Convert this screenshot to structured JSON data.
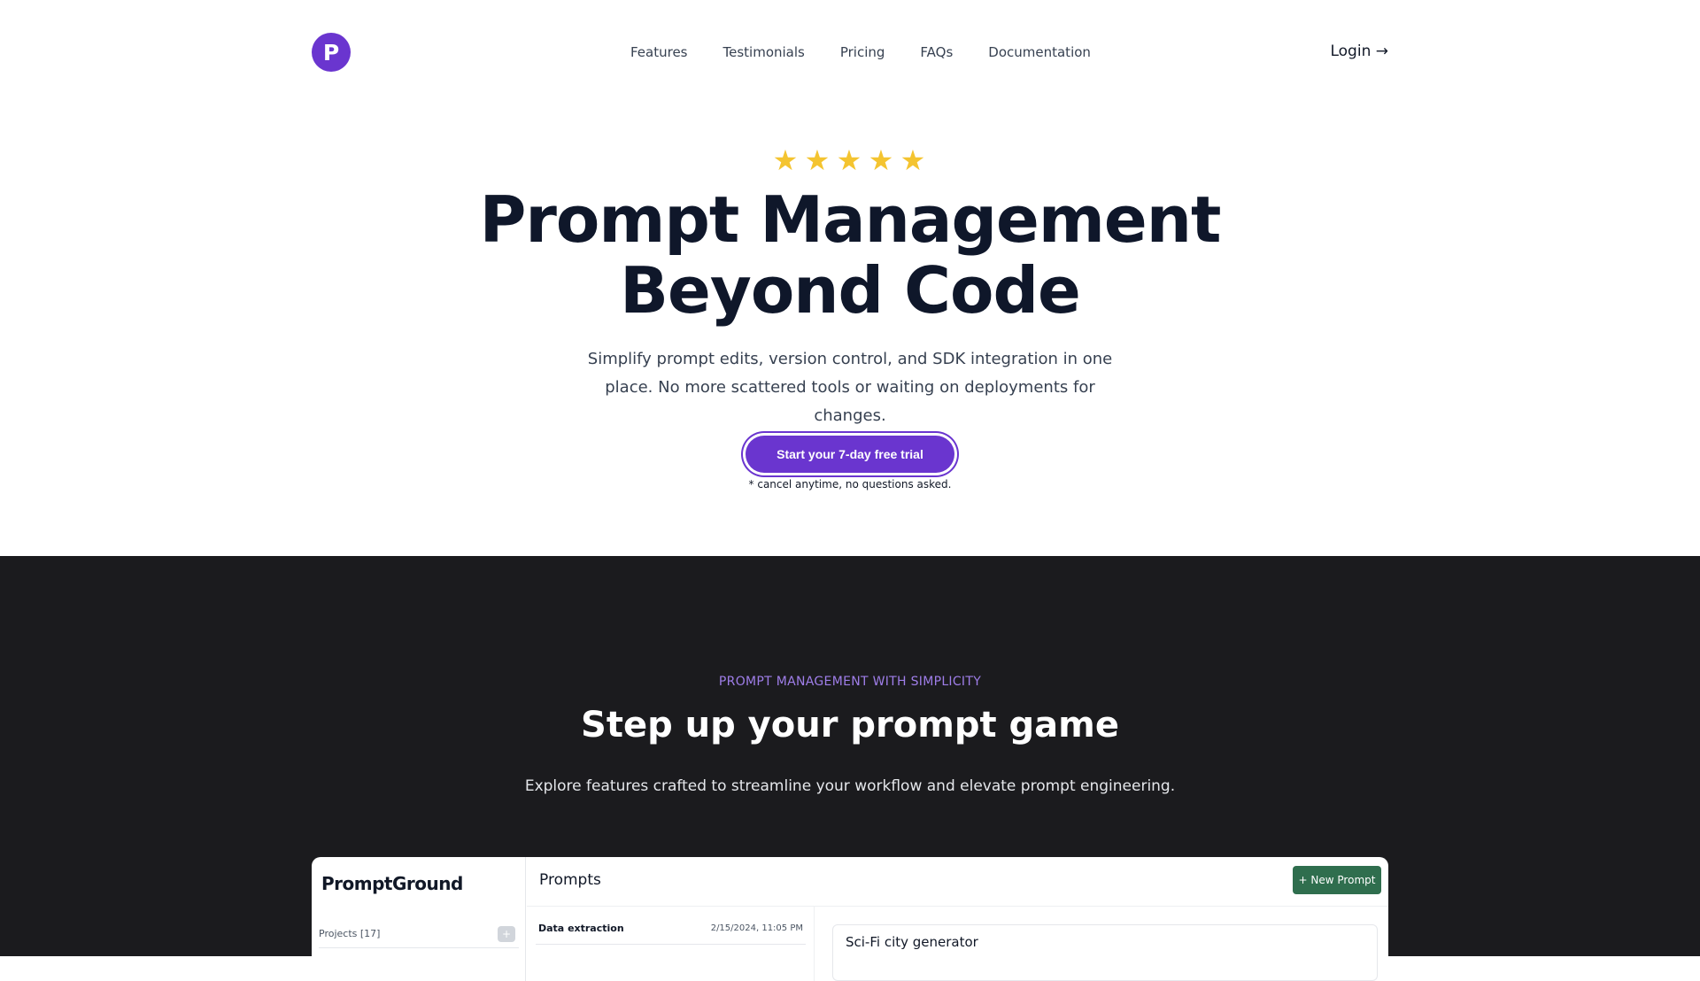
{
  "header": {
    "logo_letter": "P",
    "nav": [
      "Features",
      "Testimonials",
      "Pricing",
      "FAQs",
      "Documentation"
    ],
    "login_label": "Login →"
  },
  "hero": {
    "rating_stars": 5,
    "title_line1": "Prompt Management",
    "title_line2": "Beyond Code",
    "subtitle": "Simplify prompt edits, version control, and SDK integration in one place. No more scattered tools or waiting on deployments for changes.",
    "cta_label": "Start your 7-day free trial",
    "cta_note": "* cancel anytime, no questions asked."
  },
  "features": {
    "eyebrow": "PROMPT MANAGEMENT WITH SIMPLICITY",
    "title": "Step up your prompt game",
    "subtitle": "Explore features crafted to streamline your workflow and elevate prompt engineering."
  },
  "app_preview": {
    "brand": "PromptGround",
    "projects_label": "Projects [17]",
    "plus_label": "+",
    "prompts_label": "Prompts",
    "new_prompt_label": "+ New Prompt",
    "list_item_title": "Data extraction",
    "list_item_date": "2/15/2024, 11:05 PM",
    "editor_title": "Sci-Fi city generator"
  },
  "colors": {
    "brand": "#6a35cf",
    "star": "#f4c430",
    "dark_bg": "#1b1b1e",
    "eyebrow": "#9f7ee9",
    "new_prompt_bg": "#2f6e4e"
  },
  "icons": {
    "star": "star-icon",
    "arrow": "arrow-right-icon"
  }
}
